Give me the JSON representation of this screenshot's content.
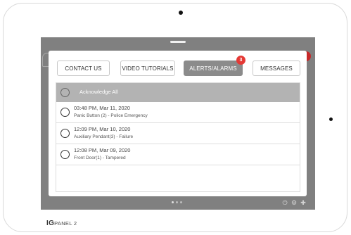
{
  "tabs": [
    {
      "label": "CONTACT US",
      "active": false
    },
    {
      "label": "VIDEO TUTORIALS",
      "active": false
    },
    {
      "label": "ALERTS/ALARMS",
      "active": true,
      "badge": "3"
    },
    {
      "label": "MESSAGES",
      "active": false
    }
  ],
  "acknowledge_all_label": "Acknowledge All",
  "alerts": [
    {
      "time": "03:48 PM, Mar 11, 2020",
      "description": "Panic Button (2) - Police Emergency"
    },
    {
      "time": "12:09 PM, Mar 10, 2020",
      "description": "Auxiliary Pendant(3) - Failure"
    },
    {
      "time": "12:08 PM, Mar 09, 2020",
      "description": "Front Door(1) - Tampered"
    }
  ],
  "brand": {
    "logo_text": "IG",
    "name": "PANEL 2"
  },
  "colors": {
    "screen_bg": "#808080",
    "active_tab": "#8b8b8b",
    "badge": "#e53935",
    "ack_row": "#b3b3b3"
  },
  "icons": [
    "camera-icon",
    "home-icon",
    "notification-badge-icon",
    "power-icon",
    "settings-icon",
    "add-icon"
  ]
}
